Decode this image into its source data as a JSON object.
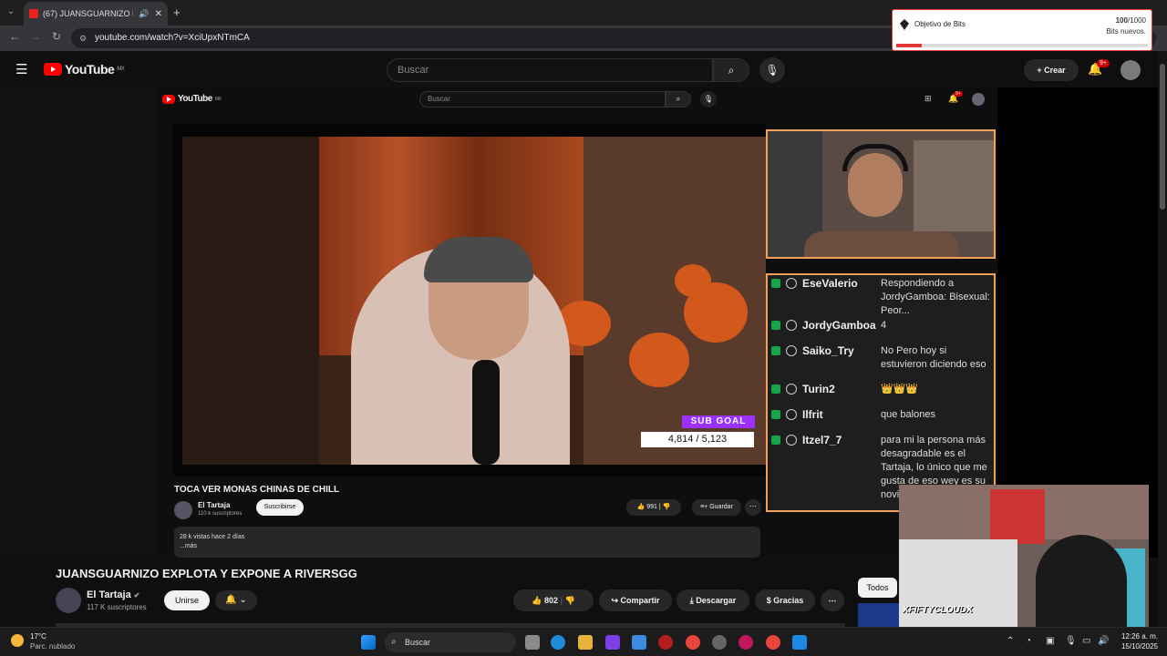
{
  "browser": {
    "tab_title": "(67) JUANSGUARNIZO EXPL",
    "url": "youtube.com/watch?v=XciUpxNTmCA"
  },
  "bits_popup": {
    "label": "Objetivo de Bits",
    "current": "100",
    "goal": "/1000",
    "subtitle": "Bits nuevos.",
    "progress": 0.1
  },
  "header": {
    "logo_text": "YouTube",
    "region": "MX",
    "search_placeholder": "Buscar",
    "create_label": "Crear",
    "notif_badge": "9+"
  },
  "inner_page": {
    "logo_text": "YouTube",
    "region": "MX",
    "search_placeholder": "Buscar",
    "notif_badge": "9+",
    "sub_goal_label": "SUB GOAL",
    "sub_goal_count": "4,814   / 5,123",
    "title": "TOCA VER MONAS CHINAS DE CHILL",
    "channel": "El Tartaja",
    "channel_subs": "110 k suscriptores",
    "subscribe_label": "Suscribirse",
    "likes": "991",
    "save_label": "Guardar",
    "desc_line1": "28 k vistas  hace 2 días",
    "desc_line2": "...más"
  },
  "chat": [
    {
      "user": "EseValerio",
      "msg": "Respondiendo a JordyGamboa: Bisexual: Peor..."
    },
    {
      "user": "JordyGamboa",
      "msg": "4"
    },
    {
      "user": "Saiko_Try",
      "msg": "No Pero hoy si estuvieron diciendo eso"
    },
    {
      "user": "Turin2",
      "msg": "👑👑👑"
    },
    {
      "user": "Ilfrit",
      "msg": "que balones"
    },
    {
      "user": "Itzel7_7",
      "msg": "para mi la persona más desagradable es el Tartaja, lo único que me gusta de eso wey es su novi"
    }
  ],
  "webcam_watermark": "XFIFTYCLOUDX",
  "video": {
    "title": "JUANSGUARNIZO EXPLOTA Y EXPONE A RIVERSGG",
    "channel": "El Tartaja",
    "subs": "117 K suscriptores",
    "join_label": "Unirse",
    "likes": "802",
    "share_label": "Compartir",
    "download_label": "Descargar",
    "thanks_label": "Gracias"
  },
  "filter_chip": "Todos",
  "taskbar": {
    "temperature": "17°C",
    "weather": "Parc. nublado",
    "search_placeholder": "Buscar",
    "time": "12:26 a. m.",
    "date": "15/10/2025"
  }
}
